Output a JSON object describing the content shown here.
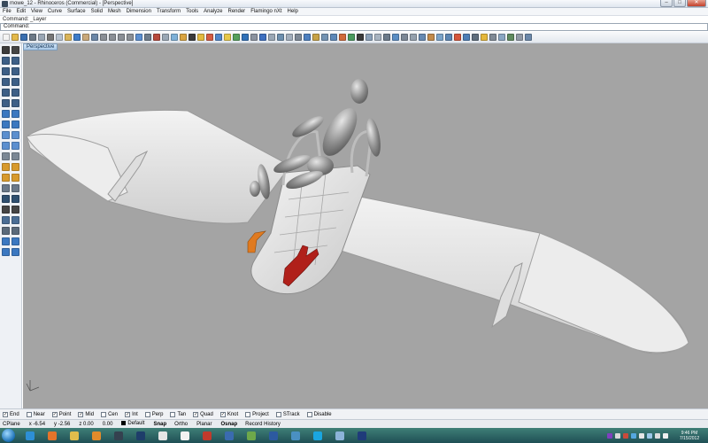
{
  "window": {
    "title": "mowe_12 - Rhinoceros (Commercial) - [Perspective]",
    "controls": {
      "minimize": "–",
      "maximize": "□",
      "close": "✕"
    }
  },
  "menu": [
    "File",
    "Edit",
    "View",
    "Curve",
    "Surface",
    "Solid",
    "Mesh",
    "Dimension",
    "Transform",
    "Tools",
    "Analyze",
    "Render",
    "Flamingo nXt",
    "Help"
  ],
  "command": {
    "history": "Command: _Layer",
    "prompt": "Command:"
  },
  "toolbar": {
    "icons": [
      {
        "name": "new-icon",
        "color": "#f3f3f3"
      },
      {
        "name": "open-icon",
        "color": "#e3b94a"
      },
      {
        "name": "save-icon",
        "color": "#3a6fb0"
      },
      {
        "name": "print-icon",
        "color": "#6d7a88"
      },
      {
        "name": "import-icon",
        "color": "#9aa7b5"
      },
      {
        "name": "cut-icon",
        "color": "#777777"
      },
      {
        "name": "copy-icon",
        "color": "#b8c3cf"
      },
      {
        "name": "paste-icon",
        "color": "#d9b45a"
      },
      {
        "name": "undo-icon",
        "color": "#3d7cc9"
      },
      {
        "name": "pan-icon",
        "color": "#c9a87a"
      },
      {
        "name": "rotate-view-icon",
        "color": "#6b87a8"
      },
      {
        "name": "zoom-icon",
        "color": "#8a8f96"
      },
      {
        "name": "zoom-window-icon",
        "color": "#8a8f96"
      },
      {
        "name": "zoom-extents-icon",
        "color": "#8a8f96"
      },
      {
        "name": "zoom-selected-icon",
        "color": "#8a8f96"
      },
      {
        "name": "undo-view-icon",
        "color": "#5b8fd1"
      },
      {
        "name": "four-views-icon",
        "color": "#6e7c8b"
      },
      {
        "name": "cplane-icon",
        "color": "#b84a3c"
      },
      {
        "name": "wireframe-icon",
        "color": "#9aa7b5"
      },
      {
        "name": "shaded-icon",
        "color": "#7db0d8"
      },
      {
        "name": "rendered-icon",
        "color": "#d9a441"
      },
      {
        "name": "point-icon",
        "color": "#3a3a3a"
      },
      {
        "name": "layer-icon",
        "color": "#e2b93f"
      },
      {
        "name": "properties-icon",
        "color": "#d45b42"
      },
      {
        "name": "render-icon",
        "color": "#4f86c9"
      },
      {
        "name": "light-icon",
        "color": "#e6c84a"
      },
      {
        "name": "material-icon",
        "color": "#55a05b"
      },
      {
        "name": "environment-icon",
        "color": "#2f70b8"
      },
      {
        "name": "options-icon",
        "color": "#8b93a0"
      },
      {
        "name": "help-icon",
        "color": "#3d6fc0"
      },
      {
        "name": "tool-icon",
        "color": "#9aa7b5"
      },
      {
        "name": "grid-icon",
        "color": "#6d8fae"
      },
      {
        "name": "group-icon",
        "color": "#a2aebc"
      },
      {
        "name": "hide-icon",
        "color": "#7d8896"
      },
      {
        "name": "show-icon",
        "color": "#4c7fbf"
      },
      {
        "name": "lock-icon",
        "color": "#c7a246"
      },
      {
        "name": "select-icon",
        "color": "#7393b3"
      },
      {
        "name": "filter-icon",
        "color": "#5d88b8"
      },
      {
        "name": "analyze-icon",
        "color": "#d06a3a"
      },
      {
        "name": "curvature-icon",
        "color": "#4a9a5e"
      },
      {
        "name": "zebra-icon",
        "color": "#3b3b3b"
      },
      {
        "name": "draft-icon",
        "color": "#8aa0b8"
      },
      {
        "name": "mesh-icon",
        "color": "#a7b3c0"
      },
      {
        "name": "edit-icon",
        "color": "#6c7b8b"
      },
      {
        "name": "dim-icon",
        "color": "#5b8ec4"
      },
      {
        "name": "text-icon",
        "color": "#7b8796"
      },
      {
        "name": "hatch-icon",
        "color": "#94a0ad"
      },
      {
        "name": "block-icon",
        "color": "#6689b1"
      },
      {
        "name": "boolean-icon",
        "color": "#c18a4b"
      },
      {
        "name": "fillet-icon",
        "color": "#7aa3c9"
      },
      {
        "name": "extrude-icon",
        "color": "#5c86b3"
      },
      {
        "name": "flamingo-icon",
        "color": "#d5563b"
      },
      {
        "name": "nxt-icon",
        "color": "#4d7eb6"
      },
      {
        "name": "camera-icon",
        "color": "#5e6d7d"
      },
      {
        "name": "sun-icon",
        "color": "#e4b73b"
      },
      {
        "name": "ground-icon",
        "color": "#7f8a96"
      },
      {
        "name": "decal-icon",
        "color": "#8aa6c2"
      },
      {
        "name": "texture-icon",
        "color": "#5f8a5f"
      },
      {
        "name": "settings-icon",
        "color": "#9099a6"
      },
      {
        "name": "plugin-icon",
        "color": "#6b88aa"
      }
    ]
  },
  "left_toolbar": {
    "icons": [
      {
        "name": "select-arrow-icon",
        "color": "#3b3b3b"
      },
      {
        "name": "point-tool-icon",
        "color": "#444444"
      },
      {
        "name": "polyline-icon",
        "color": "#3d5f86"
      },
      {
        "name": "curve-icon",
        "color": "#3d5f86"
      },
      {
        "name": "line-icon",
        "color": "#3d5f86"
      },
      {
        "name": "arc-icon",
        "color": "#3d5f86"
      },
      {
        "name": "circle-icon",
        "color": "#3d5f86"
      },
      {
        "name": "ellipse-icon",
        "color": "#3d5f86"
      },
      {
        "name": "rectangle-icon",
        "color": "#3d5f86"
      },
      {
        "name": "polygon-icon",
        "color": "#3d5f86"
      },
      {
        "name": "freeform-icon",
        "color": "#3d5f86"
      },
      {
        "name": "helix-icon",
        "color": "#3d5f86"
      },
      {
        "name": "plane-surface-icon",
        "color": "#3b78c0"
      },
      {
        "name": "extrude-surface-icon",
        "color": "#3b78c0"
      },
      {
        "name": "box-icon",
        "color": "#3b78c0"
      },
      {
        "name": "sphere-icon",
        "color": "#3b78c0"
      },
      {
        "name": "loft-icon",
        "color": "#5b8fcf"
      },
      {
        "name": "sweep-icon",
        "color": "#5b8fcf"
      },
      {
        "name": "revolve-icon",
        "color": "#5b8fcf"
      },
      {
        "name": "network-icon",
        "color": "#5b8fcf"
      },
      {
        "name": "mesh-tool-icon",
        "color": "#7a8795"
      },
      {
        "name": "mesh-edit-icon",
        "color": "#7a8795"
      },
      {
        "name": "move-icon",
        "color": "#d79a2d"
      },
      {
        "name": "copy-tool-icon",
        "color": "#d79a2d"
      },
      {
        "name": "rotate-icon",
        "color": "#d79a2d"
      },
      {
        "name": "scale-icon",
        "color": "#d79a2d"
      },
      {
        "name": "mirror-icon",
        "color": "#6a7888"
      },
      {
        "name": "array-icon",
        "color": "#6a7888"
      },
      {
        "name": "join-icon",
        "color": "#2f4f6f"
      },
      {
        "name": "explode-icon",
        "color": "#2f4f6f"
      },
      {
        "name": "trim-icon",
        "color": "#444444"
      },
      {
        "name": "split-icon",
        "color": "#444444"
      },
      {
        "name": "fillet-tool-icon",
        "color": "#4a6d94"
      },
      {
        "name": "offset-icon",
        "color": "#4a6d94"
      },
      {
        "name": "dimension-tool-icon",
        "color": "#5a6a7a"
      },
      {
        "name": "text-tool-icon",
        "color": "#5a6a7a"
      },
      {
        "name": "solid-tool-icon",
        "color": "#3b78c0"
      },
      {
        "name": "boolean-tool-icon",
        "color": "#3b78c0"
      },
      {
        "name": "analyze-tool-icon",
        "color": "#3b78c0"
      },
      {
        "name": "render-tool-icon",
        "color": "#3b78c0"
      }
    ]
  },
  "viewport": {
    "label": "Perspective",
    "background": "#a4a4a4",
    "scene_objects": [
      "flying-wing-model",
      "human-figure-model"
    ],
    "highlight_colors": {
      "orange": "#e07a20",
      "red": "#b0201a"
    }
  },
  "osnaps": [
    {
      "label": "End",
      "checked": true
    },
    {
      "label": "Near",
      "checked": false
    },
    {
      "label": "Point",
      "checked": true
    },
    {
      "label": "Mid",
      "checked": true
    },
    {
      "label": "Cen",
      "checked": false
    },
    {
      "label": "Int",
      "checked": true
    },
    {
      "label": "Perp",
      "checked": false
    },
    {
      "label": "Tan",
      "checked": false
    },
    {
      "label": "Quad",
      "checked": true
    },
    {
      "label": "Knot",
      "checked": true
    },
    {
      "label": "Project",
      "checked": false
    },
    {
      "label": "STrack",
      "checked": false
    },
    {
      "label": "Disable",
      "checked": false
    }
  ],
  "status": {
    "cplane": "CPlane",
    "x": "x -6.54",
    "y": "y -2.56",
    "z": "z 0.00",
    "units": "0.00",
    "layer": "Default",
    "snap": "Snap",
    "ortho": "Ortho",
    "planar": "Planar",
    "osnap": "Osnap",
    "record_history": "Record History"
  },
  "taskbar": {
    "apps": [
      {
        "name": "ie-icon",
        "color": "#2d8fd6"
      },
      {
        "name": "firefox-icon",
        "color": "#e5742a"
      },
      {
        "name": "explorer-icon",
        "color": "#e0bd4c"
      },
      {
        "name": "media-player-icon",
        "color": "#e28b2b"
      },
      {
        "name": "rhino-icon",
        "color": "#34414f"
      },
      {
        "name": "photoshop-icon",
        "color": "#1e3d6a"
      },
      {
        "name": "unity-icon",
        "color": "#e6e6e6"
      },
      {
        "name": "inkscape-icon",
        "color": "#f2f2f2"
      },
      {
        "name": "sketchup-icon",
        "color": "#c23a2c"
      },
      {
        "name": "app-icon",
        "color": "#3a6bb0"
      },
      {
        "name": "chrome-icon",
        "color": "#6ea84a"
      },
      {
        "name": "app2-icon",
        "color": "#2c5aa0"
      },
      {
        "name": "network-tray-icon",
        "color": "#4a90c2"
      },
      {
        "name": "skype-icon",
        "color": "#1aa6e0"
      },
      {
        "name": "app3-icon",
        "color": "#8cb3d9"
      },
      {
        "name": "eye-icon",
        "color": "#1f3b7a"
      }
    ],
    "tray_colors": [
      "#7f3fbf",
      "#d8d8d8",
      "#c94a3a",
      "#55a7e0",
      "#e6e6e6",
      "#9cc7e8",
      "#dddddd",
      "#f0f0f0"
    ],
    "time": "9:46 PM",
    "date": "7/15/2012"
  }
}
